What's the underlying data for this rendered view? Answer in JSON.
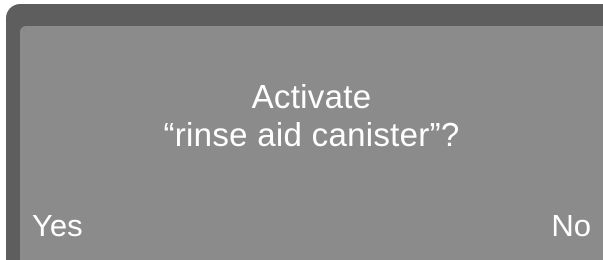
{
  "dialog": {
    "line1": "Activate",
    "line2": "“rinse aid canister”?"
  },
  "softkeys": {
    "left": "Yes",
    "right": "No"
  },
  "colors": {
    "bezel": "#5e5e5e",
    "screen": "#8b8b8b",
    "text": "#ffffff"
  }
}
